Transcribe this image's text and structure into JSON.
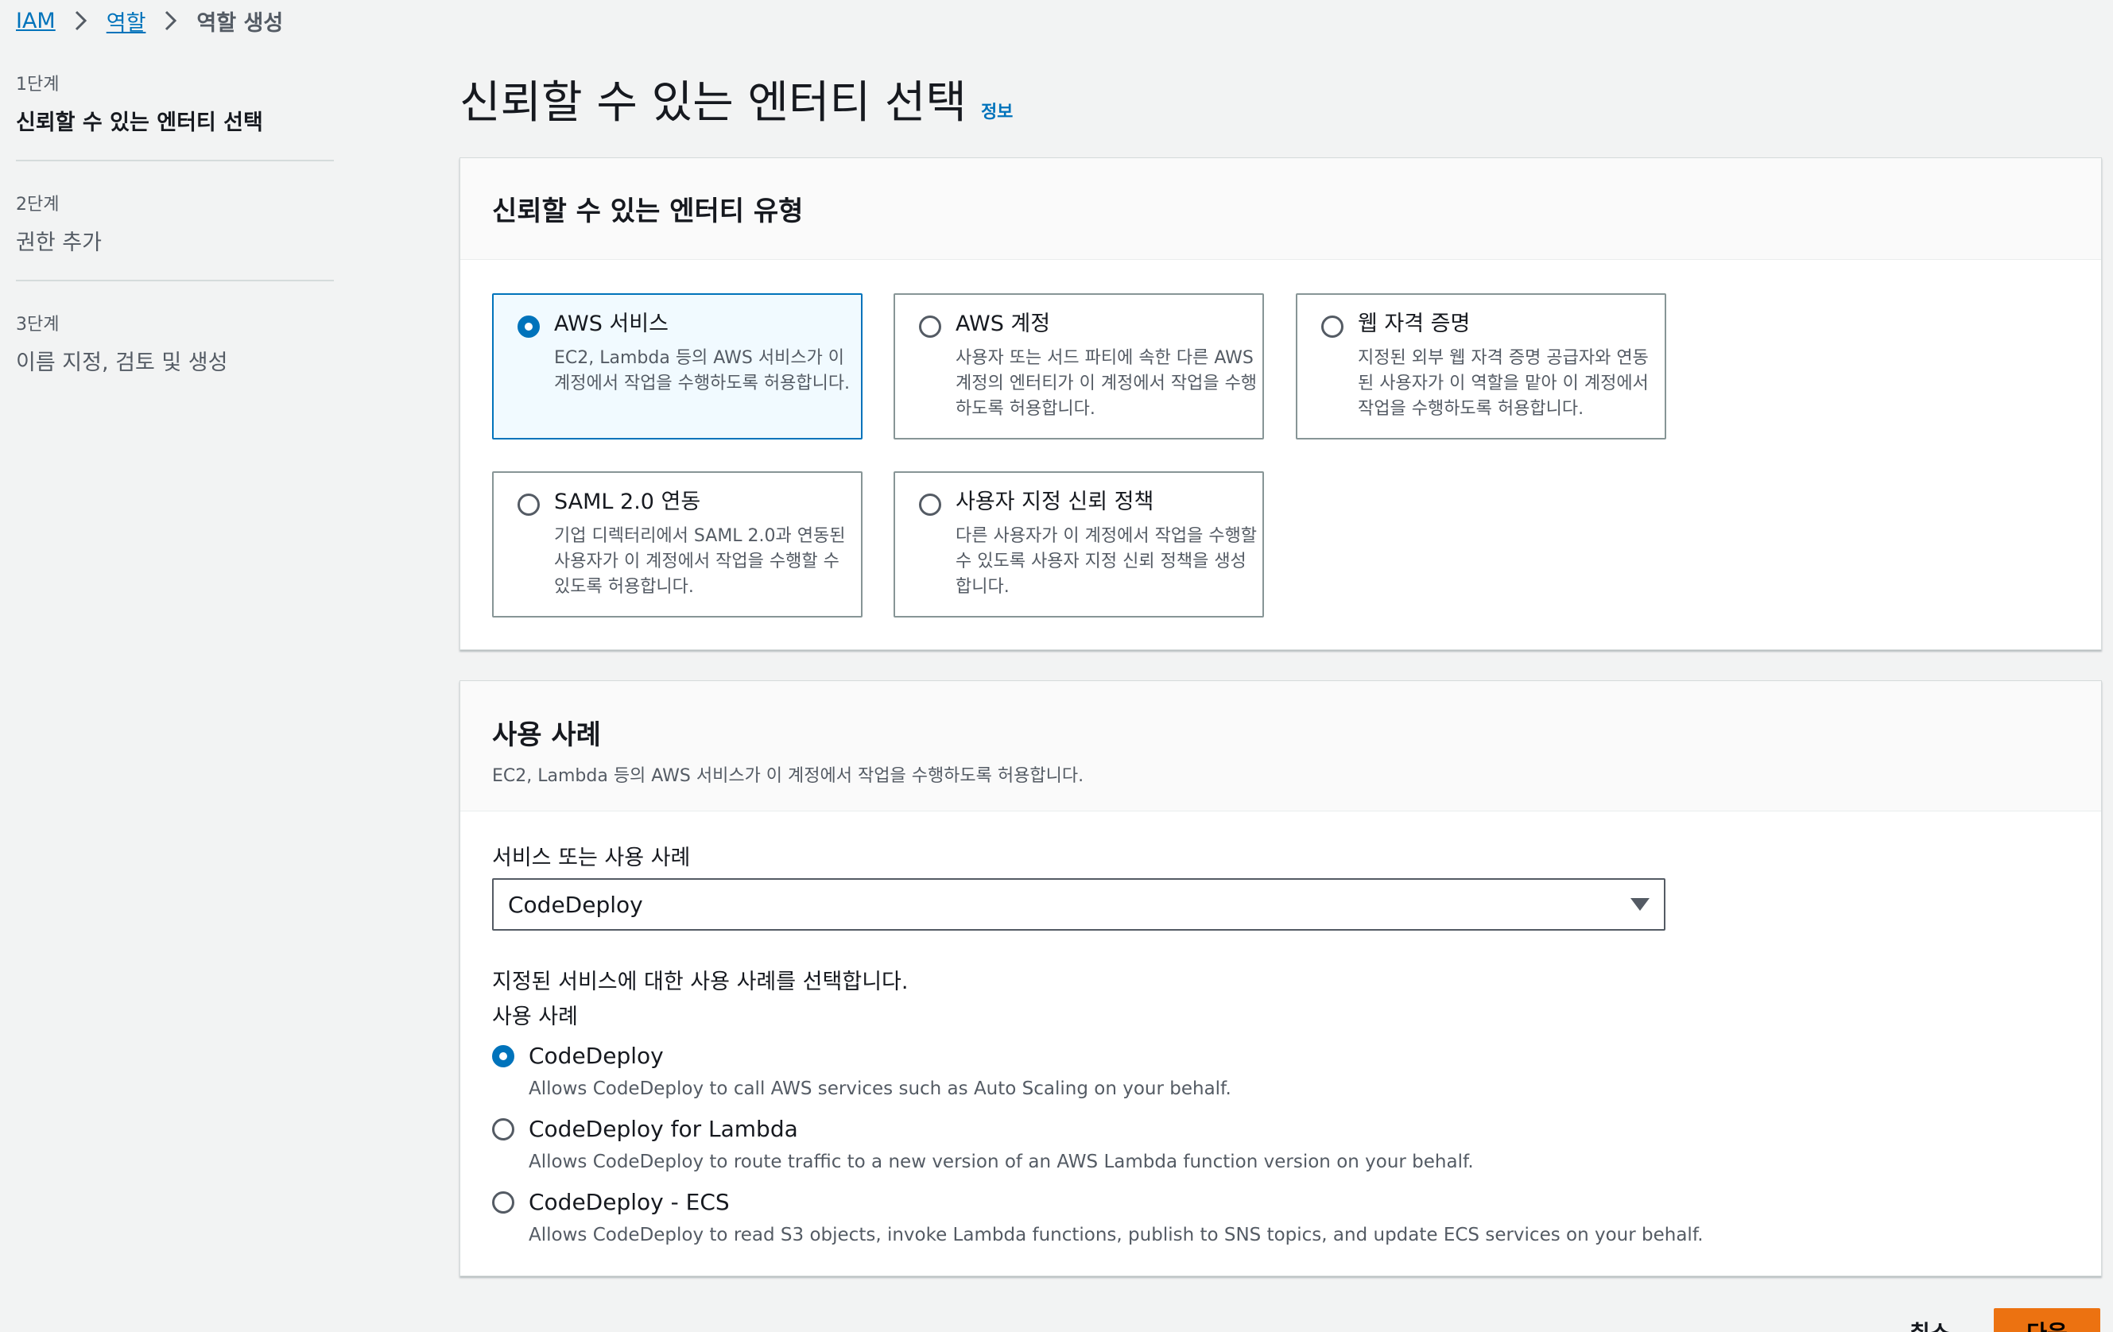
{
  "breadcrumb": {
    "items": [
      {
        "label": "IAM"
      },
      {
        "label": "역할"
      },
      {
        "label": "역할 생성"
      }
    ]
  },
  "steps": [
    {
      "number": "1단계",
      "title": "신뢰할 수 있는 엔터티 선택"
    },
    {
      "number": "2단계",
      "title": "권한 추가"
    },
    {
      "number": "3단계",
      "title": "이름 지정, 검토 및 생성"
    }
  ],
  "page": {
    "title": "신뢰할 수 있는 엔터티 선택",
    "info_label": "정보"
  },
  "entity_panel": {
    "heading": "신뢰할 수 있는 엔터티 유형",
    "options": [
      {
        "title": "AWS 서비스",
        "desc": "EC2, Lambda 등의 AWS 서비스가 이 계정에서 작업을 수행하도록 허용합니다.",
        "selected": true
      },
      {
        "title": "AWS 계정",
        "desc": "사용자 또는 서드 파티에 속한 다른 AWS 계정의 엔터티가 이 계정에서 작업을 수행하도록 허용합니다.",
        "selected": false
      },
      {
        "title": "웹 자격 증명",
        "desc": "지정된 외부 웹 자격 증명 공급자와 연동된 사용자가 이 역할을 맡아 이 계정에서 작업을 수행하도록 허용합니다.",
        "selected": false
      },
      {
        "title": "SAML 2.0 연동",
        "desc": "기업 디렉터리에서 SAML 2.0과 연동된 사용자가 이 계정에서 작업을 수행할 수 있도록 허용합니다.",
        "selected": false
      },
      {
        "title": "사용자 지정 신뢰 정책",
        "desc": "다른 사용자가 이 계정에서 작업을 수행할 수 있도록 사용자 지정 신뢰 정책을 생성합니다.",
        "selected": false
      }
    ]
  },
  "usecase_panel": {
    "heading": "사용 사례",
    "subtitle": "EC2, Lambda 등의 AWS 서비스가 이 계정에서 작업을 수행하도록 허용합니다.",
    "service_label": "서비스 또는 사용 사례",
    "service_value": "CodeDeploy",
    "choose_label": "지정된 서비스에 대한 사용 사례를 선택합니다.",
    "usecase_label": "사용 사례",
    "options": [
      {
        "title": "CodeDeploy",
        "desc": "Allows CodeDeploy to call AWS services such as Auto Scaling on your behalf.",
        "selected": true
      },
      {
        "title": "CodeDeploy for Lambda",
        "desc": "Allows CodeDeploy to route traffic to a new version of an AWS Lambda function version on your behalf.",
        "selected": false
      },
      {
        "title": "CodeDeploy - ECS",
        "desc": "Allows CodeDeploy to read S3 objects, invoke Lambda functions, publish to SNS topics, and update ECS services on your behalf.",
        "selected": false
      }
    ]
  },
  "footer": {
    "cancel_label": "취소",
    "next_label": "다음"
  },
  "colors": {
    "accent": "#0073bb",
    "primary_button": "#ec7211",
    "selected_tile_bg": "#f1faff"
  }
}
